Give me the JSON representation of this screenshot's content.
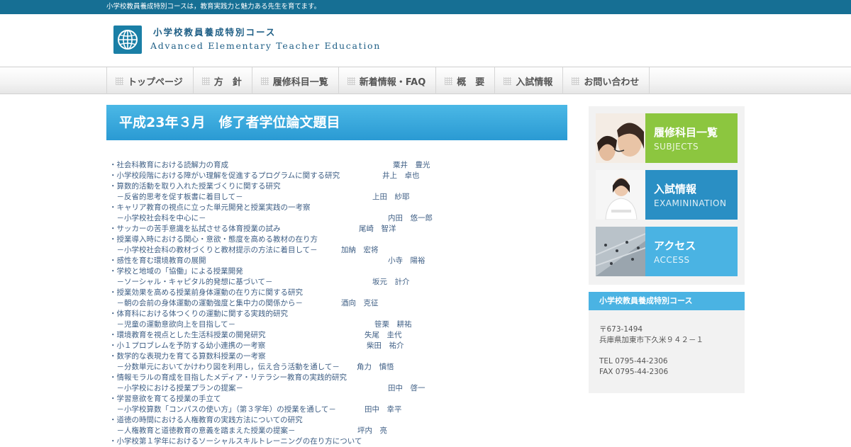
{
  "topbar": {
    "tagline": "小学校教員養成特別コースは，教育実践力と魅力ある先生を育てます。"
  },
  "header": {
    "title_jp": "小学校教員養成特別コース",
    "title_en": "Advanced Elementary Teacher Education",
    "logo_icon": "globe-icon"
  },
  "nav": {
    "items": [
      {
        "label": "トップページ"
      },
      {
        "label": "方　針"
      },
      {
        "label": "履修科目一覧"
      },
      {
        "label": "新着情報・FAQ"
      },
      {
        "label": "概　要"
      },
      {
        "label": "入試情報"
      },
      {
        "label": "お問い合わせ"
      }
    ]
  },
  "main": {
    "heading": "平成23年３月　修了者学位論文題目",
    "entries": [
      {
        "text": "・社会科教育における読解力の育成",
        "author": "粟井　豊光"
      },
      {
        "text": "・小学校段階における障がい理解を促進するプログラムに関する研究",
        "author": "井上　卓也"
      },
      {
        "text": "・算数的活動を取り入れた授業づくりに関する研究",
        "author": ""
      },
      {
        "text": "　－反省的思考を促す板書に着目して－",
        "author": "上田　紗耶"
      },
      {
        "text": "・キャリア教育の視点に立った単元開発と授業実践の一考察",
        "author": ""
      },
      {
        "text": "　－小学校社会科を中心に－",
        "author": "内田　悠一郎"
      },
      {
        "text": "・サッカーの苦手意識を払拭させる体育授業の試み",
        "author": "尾崎　智洋"
      },
      {
        "text": "・授業導入時における関心・意欲・態度を高める教材の在り方",
        "author": ""
      },
      {
        "text": "　－小学校社会科の教材づくりと教材提示の方法に着目して－",
        "author": "加納　宏将"
      },
      {
        "text": "・感性を育む環境教育の展開",
        "author": "小寺　陽裕"
      },
      {
        "text": "・学校と地域の「協働」による授業開発",
        "author": ""
      },
      {
        "text": "　－ソーシャル・キャピタル的発想に基づいて－",
        "author": "坂元　計介"
      },
      {
        "text": "・授業効果を高める授業前身体運動の在り方に関する研究",
        "author": ""
      },
      {
        "text": "　－朝の会前の身体運動の運動強度と集中力の関係から－",
        "author": "酒向　克征"
      },
      {
        "text": "・体育科における体つくりの運動に関する実践的研究",
        "author": ""
      },
      {
        "text": "　－児童の運動意欲向上を目指して－",
        "author": "笹栗　耕祐"
      },
      {
        "text": "・環境教育を視点とした生活科授業の開発研究",
        "author": "失尾　圭代"
      },
      {
        "text": "・小１プロブレムを予防する幼小連携の一考察",
        "author": "柴田　祐介"
      },
      {
        "text": "・数学的な表現力を育てる算数科授業の一考察",
        "author": ""
      },
      {
        "text": "　－分数単元においてかけわり図を利用し，伝え合う活動を通して－",
        "author": "角力　慎悟"
      },
      {
        "text": "・情報モラルの育成を目指したメディア・リテラシー教育の実践的研究",
        "author": ""
      },
      {
        "text": "　－小学校における授業プランの提案－",
        "author": "田中　啓一"
      },
      {
        "text": "・学習意欲を育てる授業の手立て",
        "author": ""
      },
      {
        "text": "　－小学校算数「コンパスの使い方」（第３学年）の授業を通して－",
        "author": "田中　幸平"
      },
      {
        "text": "・道徳の時間における人権教育の実践方法についての研究",
        "author": ""
      },
      {
        "text": "　－人権教育と道徳教育の意義を踏まえた授業の提案－",
        "author": "坪内　亮"
      },
      {
        "text": "・小学校第１学年におけるソーシャルスキルトレーニングの在り方について",
        "author": ""
      }
    ]
  },
  "sidebar": {
    "banners": [
      {
        "jp": "履修科目一覧",
        "en": "SUBJECTS",
        "color": "#8cc63f"
      },
      {
        "jp": "入試情報",
        "en": "EXAMININATION",
        "color": "#2a8fc4"
      },
      {
        "jp": "アクセス",
        "en": "ACCESS",
        "color": "#4ab3e3"
      }
    ],
    "info": {
      "heading": "小学校教員養成特別コース",
      "postal": "〒673-1494",
      "address": "兵庫県加東市下久米９４２－１",
      "tel": "TEL 0795-44-2306",
      "fax": "FAX 0795-44-2306"
    }
  }
}
